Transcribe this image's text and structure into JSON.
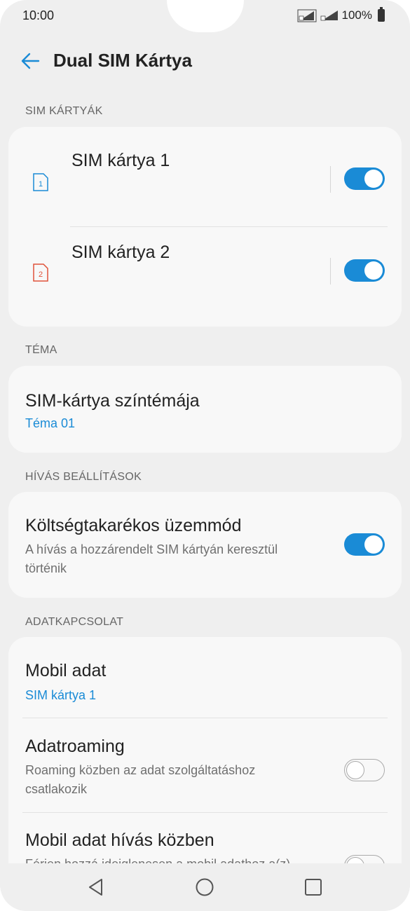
{
  "status": {
    "time": "10:00",
    "battery": "100%"
  },
  "header": {
    "title": "Dual SIM Kártya"
  },
  "sections": {
    "sim_cards": {
      "label": "SIM KÁRTYÁK",
      "items": [
        {
          "label": "SIM kártya 1",
          "icon_text": "1",
          "enabled": true,
          "icon_color": "#1a8bd6"
        },
        {
          "label": "SIM kártya 2",
          "icon_text": "2",
          "enabled": true,
          "icon_color": "#e0533a"
        }
      ]
    },
    "theme": {
      "label": "TÉMA",
      "title": "SIM-kártya színtémája",
      "value": "Téma 01"
    },
    "call_settings": {
      "label": "HÍVÁS BEÁLLÍTÁSOK",
      "title": "Költségtakarékos üzemmód",
      "subtitle_line1": "A hívás a hozzárendelt SIM kártyán keresztül",
      "subtitle_line2": "történik",
      "enabled": true
    },
    "data_connection": {
      "label": "ADATKAPCSOLAT",
      "mobile_data": {
        "title": "Mobil adat",
        "value": "SIM kártya 1"
      },
      "roaming": {
        "title": "Adatroaming",
        "subtitle_line1": "Roaming közben az adat szolgáltatáshoz",
        "subtitle_line2": "csatlakozik",
        "enabled": false
      },
      "data_during_call": {
        "title": "Mobil adat hívás közben",
        "subtitle_line1": "Férjen hozzá ideiglenesen a mobil adathoz a(z)",
        "enabled": false
      }
    }
  },
  "colors": {
    "accent": "#1a8bd6",
    "background": "#efefef",
    "card": "#f8f8f8"
  },
  "navbar": {
    "back": "back-triangle-icon",
    "home": "home-circle-icon",
    "recents": "recents-square-icon"
  }
}
